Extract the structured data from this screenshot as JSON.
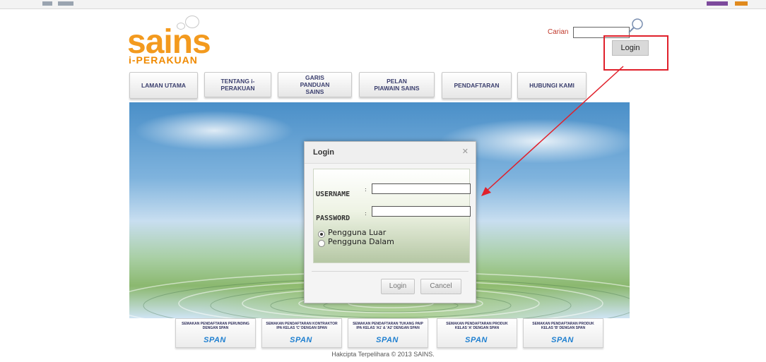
{
  "header": {
    "logo_main": "sains",
    "logo_sub": "i-PERAKUAN",
    "search_label": "Carian",
    "login_button": "Login"
  },
  "nav": {
    "items": [
      {
        "label": "LAMAN UTAMA"
      },
      {
        "label": "TENTANG i-PERAKUAN"
      },
      {
        "label": "GARIS PANDUAN SAINS"
      },
      {
        "label": "PELAN PIAWAIN SAINS"
      },
      {
        "label": "PENDAFTARAN"
      },
      {
        "label": "HUBUNGI KAMI"
      }
    ]
  },
  "dialog": {
    "title": "Login",
    "close_symbol": "✕",
    "username_label": "USERNAME",
    "password_label": "PASSWORD",
    "colon": ":",
    "username_value": "",
    "password_value": "",
    "radio_options": [
      {
        "label": "Pengguna Luar",
        "selected": true
      },
      {
        "label": "Pengguna Dalam",
        "selected": false
      }
    ],
    "login_button": "Login",
    "cancel_button": "Cancel"
  },
  "span_links": [
    {
      "text": "SEMAKAN PENDAFTARAN PERUNDING DENGAN SPAN",
      "logo": "SPAN"
    },
    {
      "text": "SEMAKAN PENDAFTARAN KONTRAKTOR IPA KELAS 'C' DENGAN SPAN",
      "logo": "SPAN"
    },
    {
      "text": "SEMAKAN PENDAFTARAN TUKANG PAIP IPA KELAS 'A1' & 'A2' DENGAN SPAN",
      "logo": "SPAN"
    },
    {
      "text": "SEMAKAN PENDAFTARAN PRODUK KELAS 'A' DENGAN SPAN",
      "logo": "SPAN"
    },
    {
      "text": "SEMAKAN PENDAFTARAN PRODUK KELAS 'B' DENGAN SPAN",
      "logo": "SPAN"
    }
  ],
  "footer": {
    "text": "Hakcipta Terpelihara © 2013 SAINS."
  },
  "colors": {
    "brand_orange": "#f39a1e",
    "annotation_red": "#e0202b",
    "nav_text": "#3b3f6e",
    "span_blue": "#1e7fd0"
  },
  "icons": {
    "search": "search-icon",
    "close": "close-icon"
  }
}
